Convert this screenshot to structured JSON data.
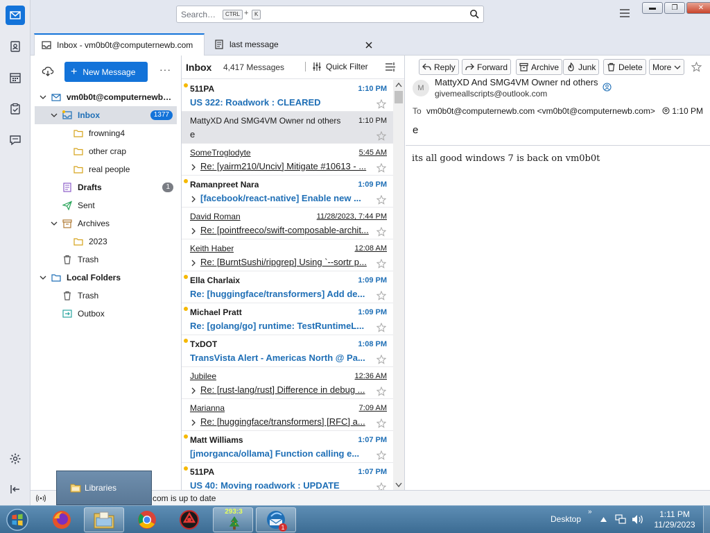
{
  "search": {
    "placeholder": "Search…",
    "kbd1": "CTRL",
    "plus": "+",
    "kbd2": "K"
  },
  "tabs": [
    {
      "label": "Inbox - vm0b0t@computernewb.com"
    },
    {
      "label": "last message"
    }
  ],
  "folders": {
    "new_message": "New Message",
    "account": "vm0b0t@computernewb.com",
    "items": [
      {
        "label": "Inbox",
        "badge": "1377"
      },
      {
        "label": "frowning4"
      },
      {
        "label": "other crap"
      },
      {
        "label": "real people"
      },
      {
        "label": "Drafts",
        "badge": "1"
      },
      {
        "label": "Sent"
      },
      {
        "label": "Archives"
      },
      {
        "label": "2023"
      },
      {
        "label": "Trash"
      },
      {
        "label": "Local Folders"
      },
      {
        "label": "Trash"
      },
      {
        "label": "Outbox"
      }
    ]
  },
  "list": {
    "title": "Inbox",
    "count": "4,417 Messages",
    "quick_filter": "Quick Filter",
    "messages": [
      {
        "from": "511PA",
        "date": "1:10 PM",
        "subject": "US 322: Roadwork : CLEARED",
        "state": "unread",
        "thread": false
      },
      {
        "from": "MattyXD And SMG4VM Owner nd others",
        "date": "1:10 PM",
        "subject": "e",
        "state": "selected",
        "thread": false
      },
      {
        "from": "SomeTroglodyte",
        "date": "5:45 AM",
        "subject": "Re: [yairm210/Unciv] Mitigate #10613 - ...",
        "state": "read",
        "thread": true
      },
      {
        "from": "Ramanpreet Nara",
        "date": "1:09 PM",
        "subject": "[facebook/react-native] Enable new ...",
        "state": "unread",
        "thread": true
      },
      {
        "from": "David Roman",
        "date": "11/28/2023, 7:44 PM",
        "subject": "Re: [pointfreeco/swift-composable-archit...",
        "state": "read",
        "thread": true
      },
      {
        "from": "Keith Haber",
        "date": "12:08 AM",
        "subject": "Re: [BurntSushi/ripgrep] Using `--sortr p...",
        "state": "read",
        "thread": true
      },
      {
        "from": "Ella Charlaix",
        "date": "1:09 PM",
        "subject": "Re: [huggingface/transformers] Add de...",
        "state": "unread",
        "thread": false
      },
      {
        "from": "Michael Pratt",
        "date": "1:09 PM",
        "subject": "Re: [golang/go] runtime: TestRuntimeL...",
        "state": "unread",
        "thread": false
      },
      {
        "from": "TxDOT",
        "date": "1:08 PM",
        "subject": "TransVista Alert - Americas North @ Pa...",
        "state": "unread",
        "thread": false
      },
      {
        "from": "Jubilee",
        "date": "12:36 AM",
        "subject": "Re: [rust-lang/rust] Difference in debug ...",
        "state": "read",
        "thread": true
      },
      {
        "from": "Marianna",
        "date": "7:09 AM",
        "subject": "Re: [huggingface/transformers] [RFC] a...",
        "state": "read",
        "thread": true
      },
      {
        "from": "Matt Williams",
        "date": "1:07 PM",
        "subject": "[jmorganca/ollama] Function calling e...",
        "state": "unread",
        "thread": false
      },
      {
        "from": "511PA",
        "date": "1:07 PM",
        "subject": "US 40: Moving roadwork : UPDATE",
        "state": "unread",
        "thread": false
      }
    ]
  },
  "reader": {
    "buttons": {
      "reply": "Reply",
      "forward": "Forward",
      "archive": "Archive",
      "junk": "Junk",
      "delete": "Delete",
      "more": "More"
    },
    "avatar": "M",
    "from_name": "MattyXD And SMG4VM Owner nd others",
    "from_addr": "givemeallscripts@outlook.com",
    "to_label": "To",
    "to_addr": "vm0b0t@computernewb.com <vm0b0t@computernewb.com>",
    "time": "1:10 PM",
    "subject": "e",
    "body": "its all good windows 7 is back on vm0b0t"
  },
  "status": {
    "text": "com is up to date",
    "popup": "Libraries"
  },
  "taskbar": {
    "counter": "293:3",
    "notif": "1",
    "desktop": "Desktop",
    "time": "1:11 PM",
    "date": "11/29/2023"
  },
  "colors": {
    "accent": "#1373d9",
    "unread_blue": "#1f6fb6",
    "unread_dot": "#f5b800"
  }
}
